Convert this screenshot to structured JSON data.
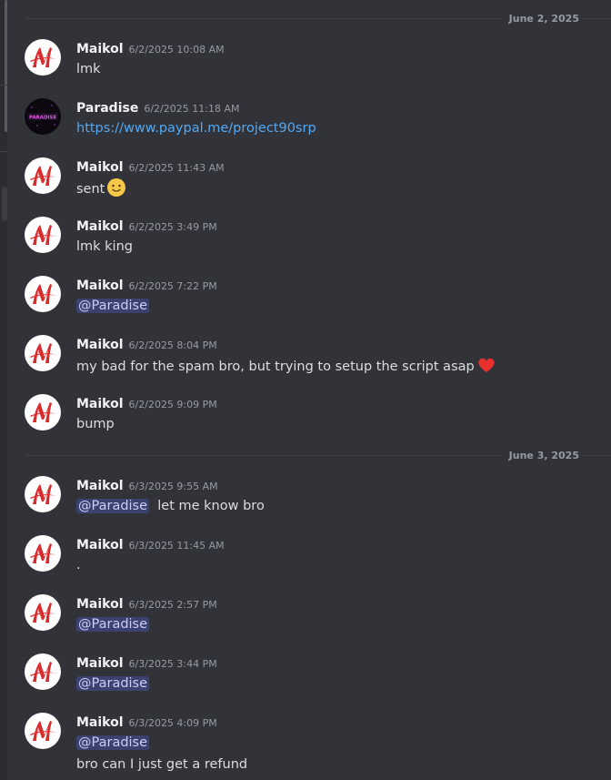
{
  "date_dividers": [
    "June 2, 2025",
    "June 3, 2025"
  ],
  "icons": {
    "maikol_avatar": "red-M-logo-icon",
    "paradise_avatar": "paradise-neon-logo-icon",
    "smile": "slightly-smiling-face-icon",
    "heart": "red-heart-icon"
  },
  "colors": {
    "background": "#323339",
    "link": "#52a9f5",
    "mention_bg": "#3c4270",
    "heart": "#e8302f"
  },
  "paradise_avatar_text": "PARADISE",
  "messages": [
    {
      "author": "Maikol",
      "time": "6/2/2025 10:08 AM",
      "text": "lmk"
    },
    {
      "author": "Paradise",
      "time": "6/2/2025 11:18 AM",
      "link": "https://www.paypal.me/project90srp"
    },
    {
      "author": "Maikol",
      "time": "6/2/2025 11:43 AM",
      "text": "sent"
    },
    {
      "author": "Maikol",
      "time": "6/2/2025 3:49 PM",
      "text": "lmk king"
    },
    {
      "author": "Maikol",
      "time": "6/2/2025 7:22 PM",
      "mention": "@Paradise"
    },
    {
      "author": "Maikol",
      "time": "6/2/2025 8:04 PM",
      "text": "my bad for the spam bro, but trying to setup the script asap"
    },
    {
      "author": "Maikol",
      "time": "6/2/2025 9:09 PM",
      "text": "bump"
    },
    {
      "author": "Maikol",
      "time": "6/3/2025 9:55 AM",
      "mention": "@Paradise",
      "text": "let me know bro"
    },
    {
      "author": "Maikol",
      "time": "6/3/2025 11:45 AM",
      "text": "."
    },
    {
      "author": "Maikol",
      "time": "6/3/2025 2:57 PM",
      "mention": "@Paradise"
    },
    {
      "author": "Maikol",
      "time": "6/3/2025 3:44 PM",
      "mention": "@Paradise"
    },
    {
      "author": "Maikol",
      "time": "6/3/2025 4:09 PM",
      "mention": "@Paradise",
      "text2": "bro can I just get a refund"
    }
  ]
}
